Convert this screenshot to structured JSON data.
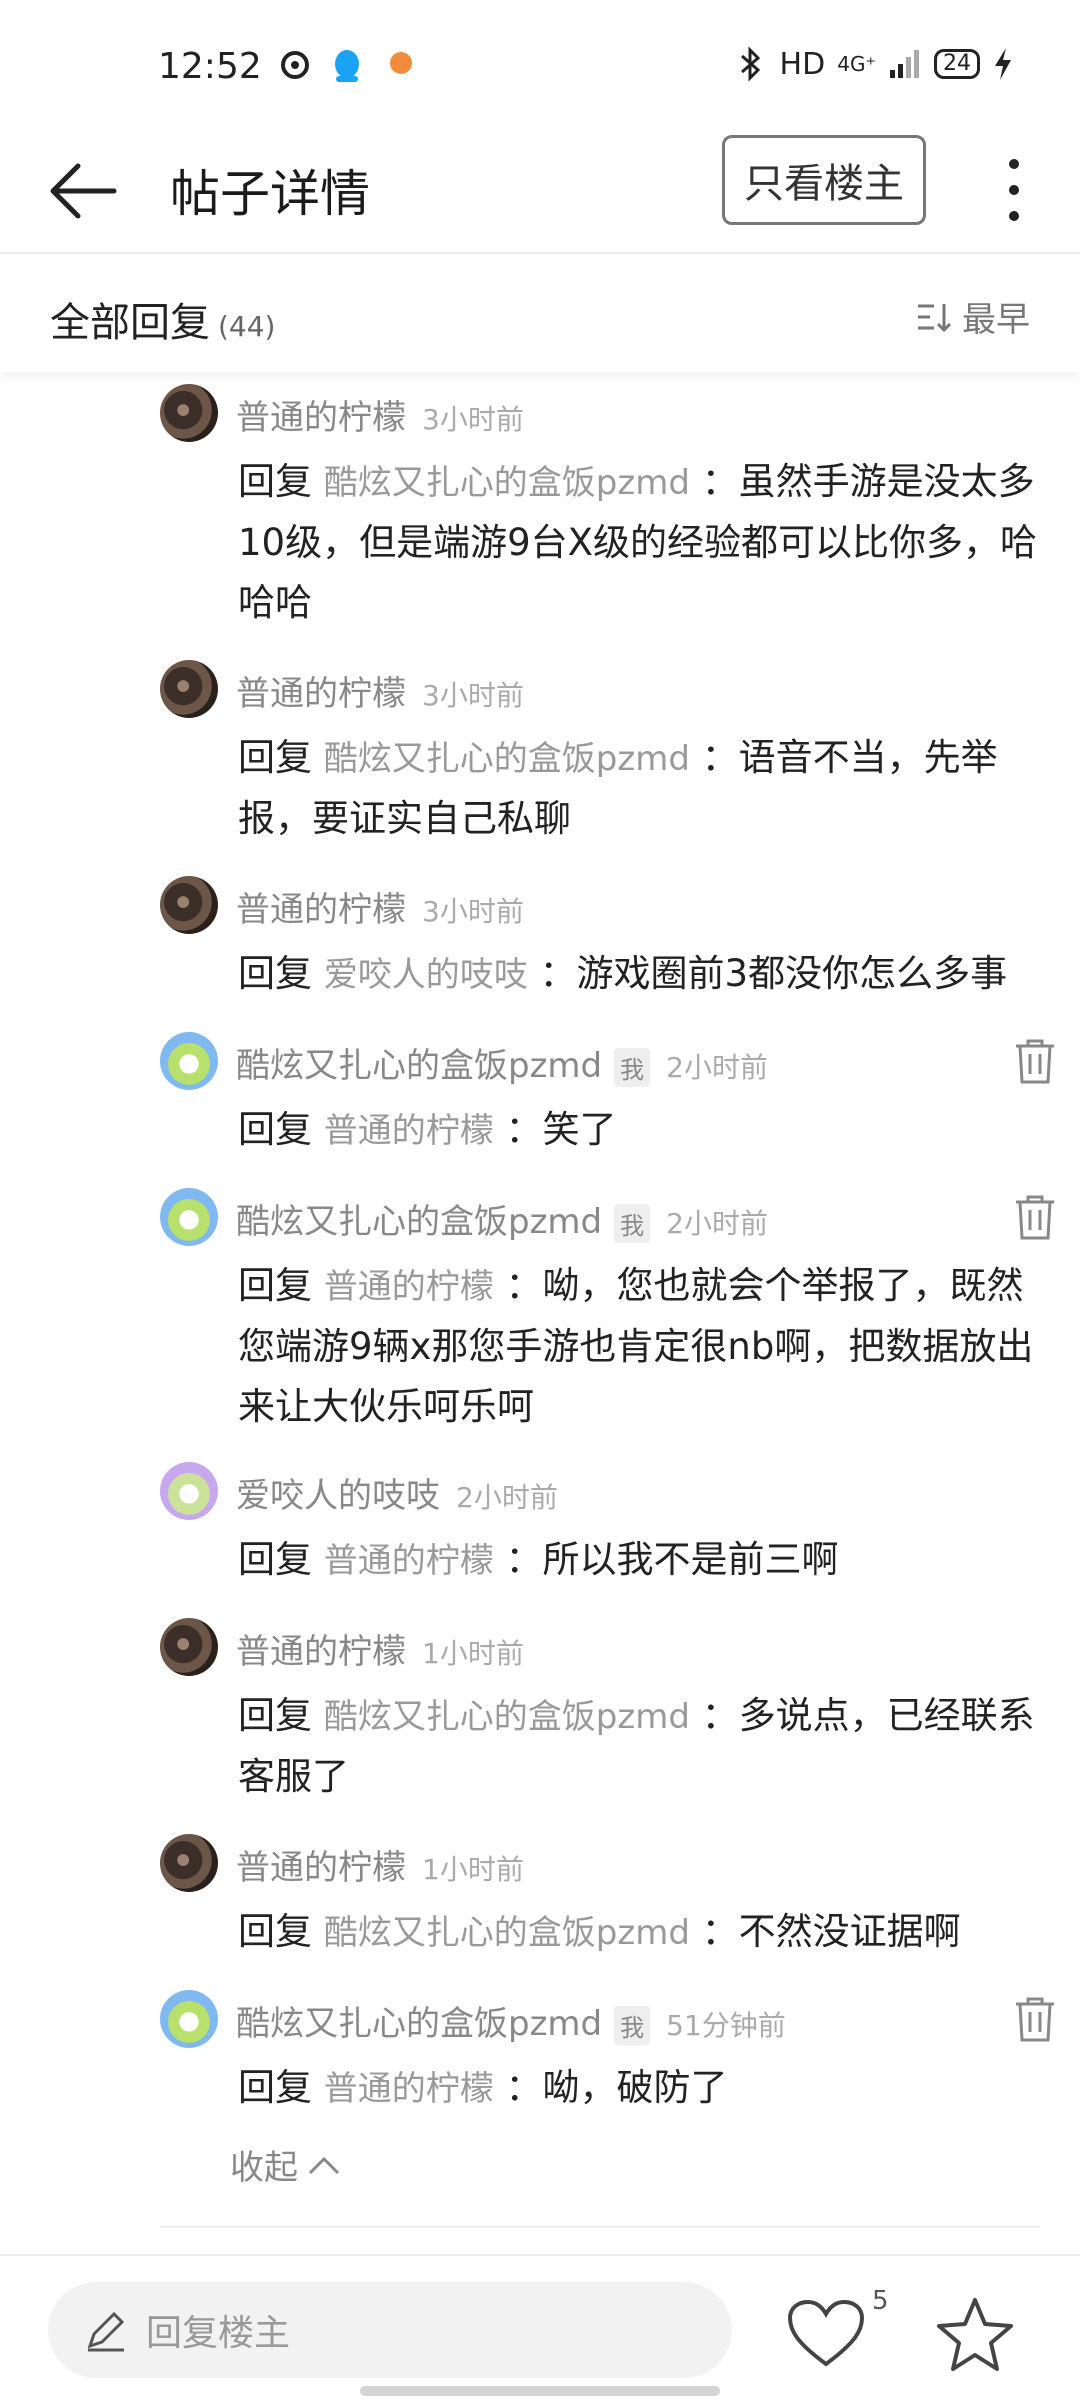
{
  "status_bar": {
    "time": "12:52",
    "network": "HD",
    "signal": "4G⁺",
    "battery": "24"
  },
  "header": {
    "title": "帖子详情",
    "only_owner_label": "只看楼主"
  },
  "sort_bar": {
    "all_replies_label": "全部回复",
    "count": "(44)",
    "sort_label": "最早"
  },
  "comments": [
    {
      "author": "普通的柠檬",
      "time": "3小时前",
      "reply_prefix": "回复",
      "reply_to": "酷炫又扎心的盒饭pzmd",
      "text": "：虽然手游是没太多10级，但是端游9台X级的经验都可以比你多，哈哈哈"
    },
    {
      "author": "普通的柠檬",
      "time": "3小时前",
      "reply_prefix": "回复",
      "reply_to": "酷炫又扎心的盒饭pzmd",
      "text": "：语音不当，先举报，要证实自己私聊"
    },
    {
      "author": "普通的柠檬",
      "time": "3小时前",
      "reply_prefix": "回复",
      "reply_to": "爱咬人的吱吱",
      "text": "：游戏圈前3都没你怎么多事"
    },
    {
      "author": "酷炫又扎心的盒饭pzmd",
      "badge": "我",
      "time": "2小时前",
      "reply_prefix": "回复",
      "reply_to": "普通的柠檬",
      "text": "：笑了"
    },
    {
      "author": "酷炫又扎心的盒饭pzmd",
      "badge": "我",
      "time": "2小时前",
      "reply_prefix": "回复",
      "reply_to": "普通的柠檬",
      "text": "：呦，您也就会个举报了，既然您端游9辆x那您手游也肯定很nb啊，把数据放出来让大伙乐呵乐呵"
    },
    {
      "author": "爱咬人的吱吱",
      "time": "2小时前",
      "reply_prefix": "回复",
      "reply_to": "普通的柠檬",
      "text": "：所以我不是前三啊"
    },
    {
      "author": "普通的柠檬",
      "time": "1小时前",
      "reply_prefix": "回复",
      "reply_to": "酷炫又扎心的盒饭pzmd",
      "text": "：多说点，已经联系客服了"
    },
    {
      "author": "普通的柠檬",
      "time": "1小时前",
      "reply_prefix": "回复",
      "reply_to": "酷炫又扎心的盒饭pzmd",
      "text": "：不然没证据啊"
    },
    {
      "author": "酷炫又扎心的盒饭pzmd",
      "badge": "我",
      "time": "51分钟前",
      "reply_prefix": "回复",
      "reply_to": "普通的柠檬",
      "text": "：呦，破防了"
    }
  ],
  "collapse_label": "收起",
  "bottom_bar": {
    "reply_placeholder": "回复楼主",
    "like_count": "5"
  }
}
